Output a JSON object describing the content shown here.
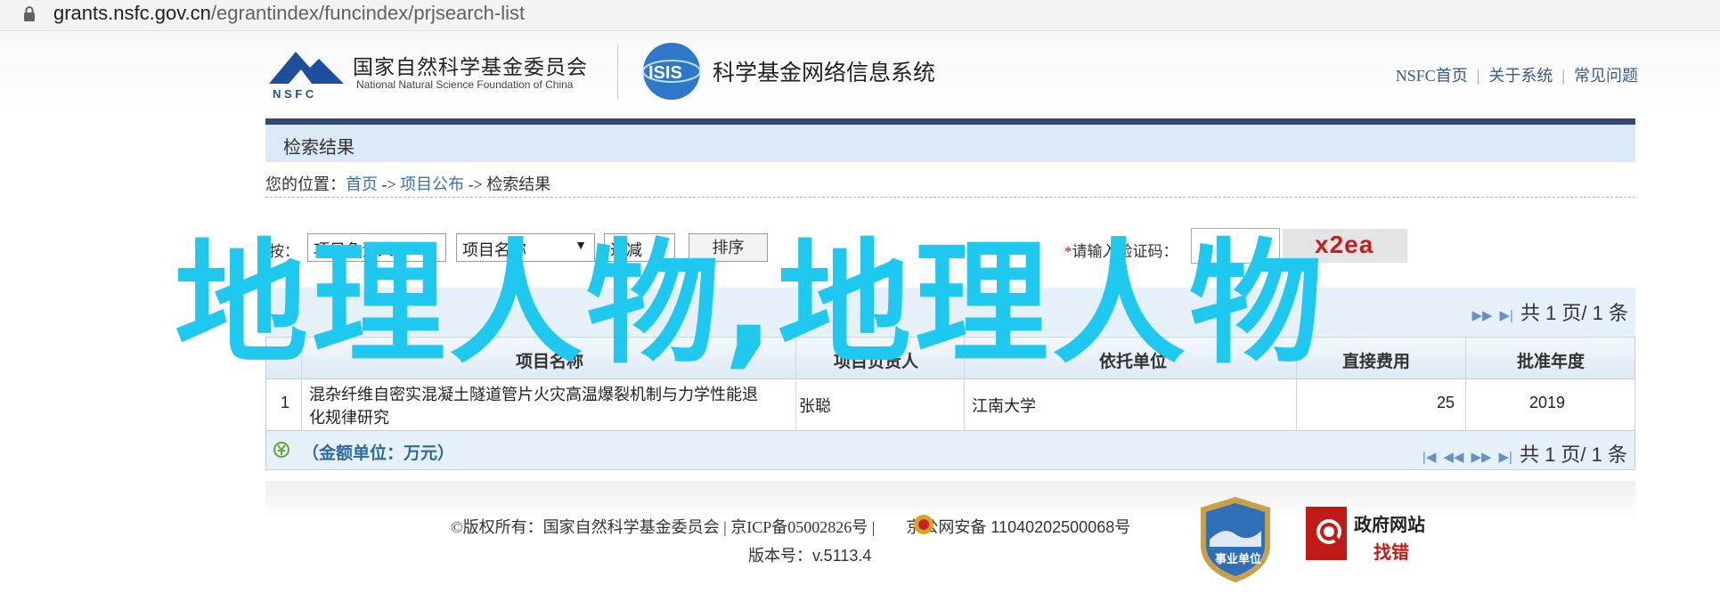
{
  "browser": {
    "url_host": "grants.nsfc.gov.cn",
    "url_path": "/egrantindex/funcindex/prjsearch-list"
  },
  "header": {
    "org_name_cn": "国家自然科学基金委员会",
    "org_name_en": "National Natural Science Foundation of China",
    "logo_text": "N S F C",
    "isis_logo_text": "ISIS",
    "system_title": "科学基金网络信息系统",
    "nav": {
      "home": "NSFC首页",
      "about": "关于系统",
      "faq": "常见问题",
      "sep": "|"
    }
  },
  "result_title": "检索结果",
  "breadcrumb": {
    "prefix": "您的位置：",
    "home": "首页",
    "arrow1": "->",
    "publish": "项目公布",
    "arrow2": "->",
    "current": "检索结果"
  },
  "sort": {
    "label": "按：",
    "field1": "项目负责人",
    "field2": "项目名称",
    "order": "递减",
    "button": "排序",
    "captcha_star": "*",
    "captcha_label": "请输入验证码：",
    "captcha_text": "x2ea"
  },
  "pager": {
    "text": "共 1 页/ 1 条"
  },
  "table": {
    "headers": [
      "项目名称",
      "项目负责人",
      "依托单位",
      "直接费用",
      "批准年度"
    ],
    "rows": [
      {
        "index": "1",
        "title_line1": "混杂纤维自密实混凝土隧道管片火灾高温爆裂机制与力学性能退",
        "title_line2": "化规律研究",
        "pi": "张聪",
        "org": "江南大学",
        "cost": "25",
        "year": "2019"
      }
    ]
  },
  "amount_unit": "（金额单位：万元）",
  "footer": {
    "copyright": "©版权所有：国家自然科学基金委员会 | 京ICP备05002826号 |",
    "police": "京公网安备 11040202500068号",
    "version_label": "版本号：",
    "version": "v.5113.4",
    "shield_text": "事业单位",
    "gov_line1": "政府网站",
    "gov_line2": "找错"
  },
  "watermark": "地理人物,地理人物",
  "colors": {
    "watermark": "#1ec8ee",
    "header_bar": "#344a6c",
    "panel": "#dbe8f5",
    "link": "#3a6fb2"
  }
}
